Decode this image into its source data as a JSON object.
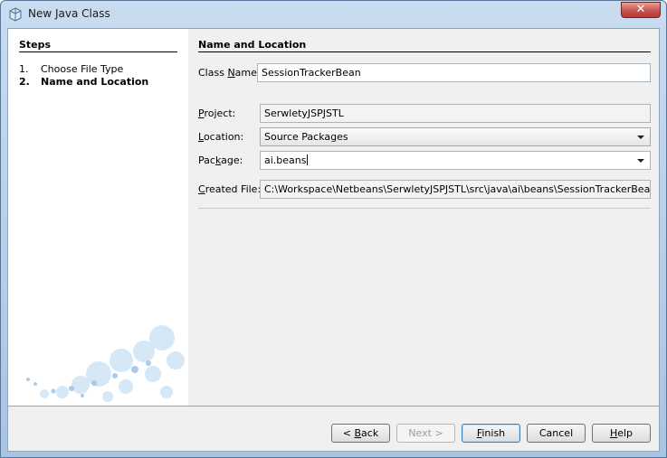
{
  "window": {
    "title": "New Java Class",
    "close_glyph": "✕"
  },
  "steps": {
    "title": "Steps",
    "items": [
      {
        "num": "1.",
        "label": "Choose File Type",
        "active": false
      },
      {
        "num": "2.",
        "label": "Name and Location",
        "active": true
      }
    ]
  },
  "form": {
    "section_title": "Name and Location",
    "class_name": {
      "label_pre": "Class ",
      "label_mnemonic": "N",
      "label_post": "ame:",
      "value": "SessionTrackerBean"
    },
    "project": {
      "label_pre": "",
      "label_mnemonic": "P",
      "label_post": "roject:",
      "value": "SerwletyJSPJSTL"
    },
    "location": {
      "label_pre": "",
      "label_mnemonic": "L",
      "label_post": "ocation:",
      "value": "Source Packages"
    },
    "package": {
      "label_pre": "Pac",
      "label_mnemonic": "k",
      "label_post": "age:",
      "value": "ai.beans"
    },
    "created_file": {
      "label_pre": "",
      "label_mnemonic": "C",
      "label_post": "reated File:",
      "value": "C:\\Workspace\\Netbeans\\SerwletyJSPJSTL\\src\\java\\ai\\beans\\SessionTrackerBean.java"
    }
  },
  "buttons": {
    "back": {
      "pre": "< ",
      "mnemonic": "B",
      "post": "ack"
    },
    "next": {
      "pre": "Next >",
      "mnemonic": "",
      "post": ""
    },
    "finish": {
      "pre": "",
      "mnemonic": "F",
      "post": "inish"
    },
    "cancel": {
      "pre": "Cancel",
      "mnemonic": "",
      "post": ""
    },
    "help": {
      "pre": "",
      "mnemonic": "H",
      "post": "elp"
    }
  }
}
